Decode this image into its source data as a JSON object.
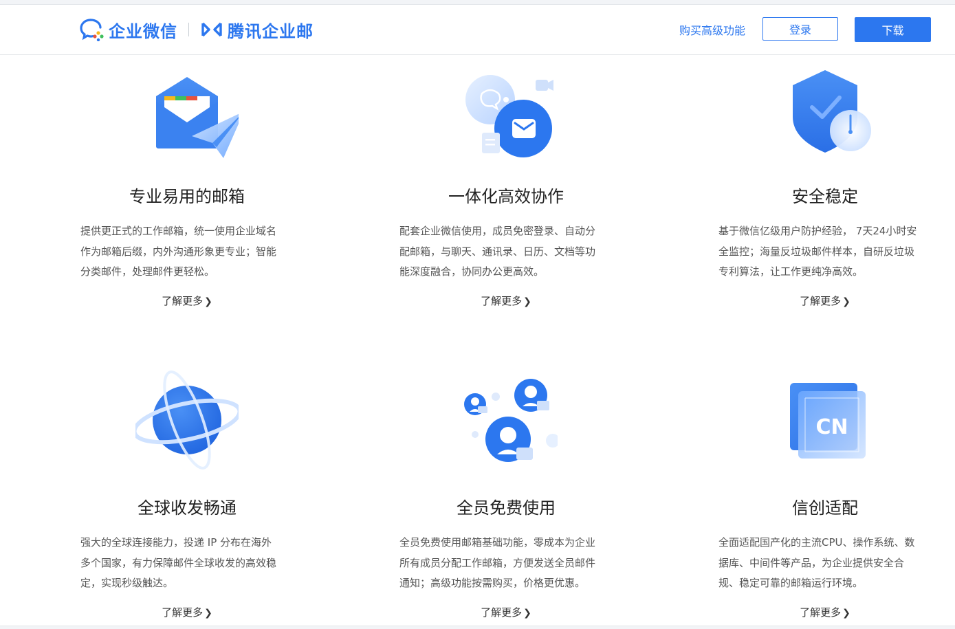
{
  "header": {
    "brand_wecom": "企业微信",
    "brand_exmail": "腾讯企业邮",
    "buy_link": "购买高级功能",
    "login_label": "登录",
    "download_label": "下载"
  },
  "colors": {
    "accent": "#2c77ef"
  },
  "features": [
    {
      "icon": "mail-send-icon",
      "title": "专业易用的邮箱",
      "lines": [
        "提供更正式的工作邮箱，统一使用企业域名",
        "作为邮箱后缀，内外沟通形象更专业；智能",
        "分类邮件，处理邮件更轻松。"
      ],
      "more": "了解更多"
    },
    {
      "icon": "collaboration-icon",
      "title": "一体化高效协作",
      "lines": [
        "配套企业微信使用，成员免密登录、自动分",
        "配邮箱，与聊天、通讯录、日历、文档等功",
        "能深度融合，协同办公更高效。"
      ],
      "more": "了解更多"
    },
    {
      "icon": "security-shield-icon",
      "title": "安全稳定",
      "lines": [
        "基于微信亿级用户防护经验， 7天24小时安",
        "全监控；海量反垃圾邮件样本，自研反垃圾",
        "专利算法，让工作更纯净高效。"
      ],
      "more": "了解更多"
    },
    {
      "icon": "globe-icon",
      "title": "全球收发畅通",
      "lines": [
        "强大的全球连接能力，投递 IP 分布在海外",
        "多个国家，有力保障邮件全球收发的高效稳",
        "定，实现秒级触达。"
      ],
      "more": "了解更多"
    },
    {
      "icon": "members-icon",
      "title": "全员免费使用",
      "lines": [
        "全员免费使用邮箱基础功能，零成本为企业",
        "所有成员分配工作邮箱，方便发送全员邮件",
        "通知；高级功能按需购买，价格更优惠。"
      ],
      "more": "了解更多"
    },
    {
      "icon": "cn-chip-icon",
      "title": "信创适配",
      "chip_text": "CN",
      "lines": [
        "全面适配国产化的主流CPU、操作系统、数",
        "据库、中间件等产品，为企业提供安全合",
        "规、稳定可靠的邮箱运行环境。"
      ],
      "more": "了解更多"
    }
  ]
}
